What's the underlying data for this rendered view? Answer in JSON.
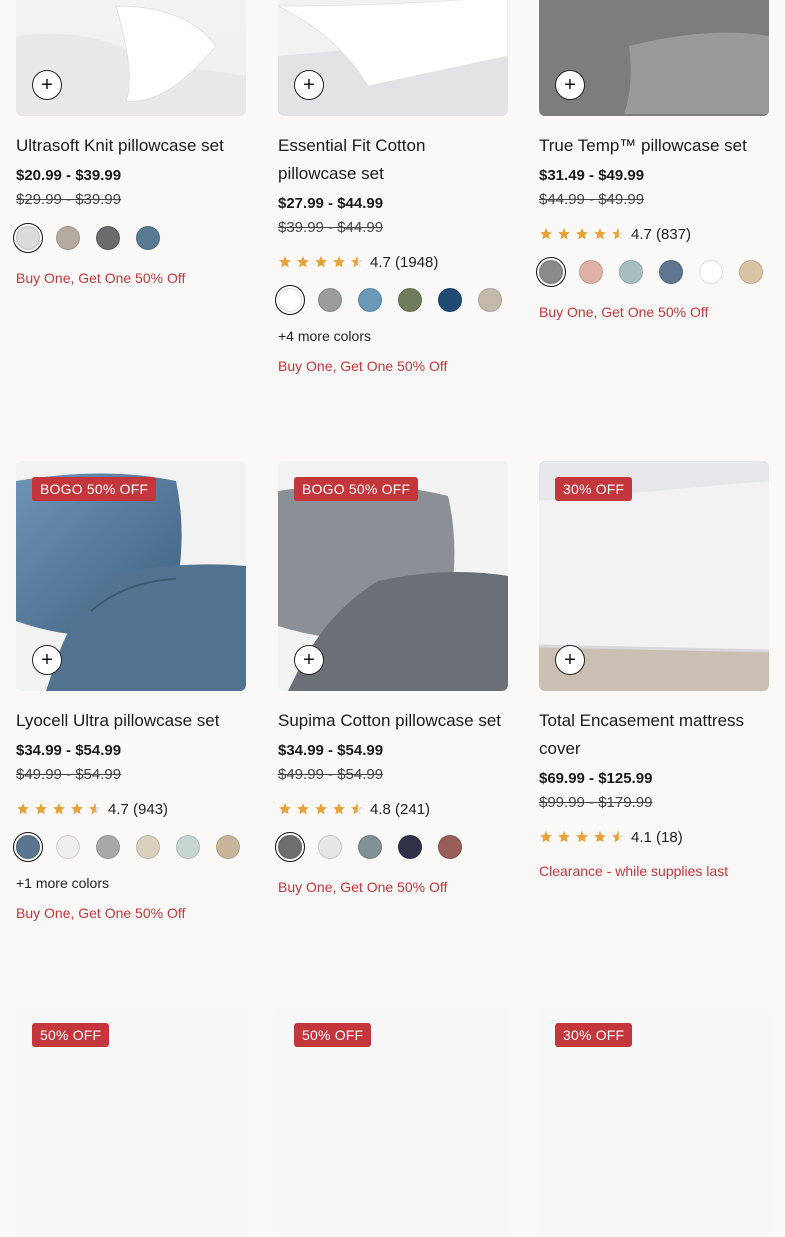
{
  "add_icon": "+",
  "colors": {
    "promo": "#c2363c",
    "star": "#e8a23a",
    "badge_bg": "#c2363c"
  },
  "products": [
    {
      "title": "Ultrasoft Knit pillowcase set",
      "price": "$20.99 - $39.99",
      "original_price": "$29.99 - $39.99",
      "swatches": [
        "#dcdcdc",
        "#b5aaa0",
        "#6a6a6a",
        "#587a92"
      ],
      "promo": "Buy One, Get One 50% Off"
    },
    {
      "title": "Essential Fit Cotton pillowcase set",
      "price": "$27.99 - $44.99",
      "original_price": "$39.99 - $44.99",
      "rating": 4.7,
      "rating_text": "4.7",
      "reviews": "(1948)",
      "swatches": [
        "#ffffff",
        "#9a9d9b",
        "#6a98b6",
        "#6e7e5d",
        "#1f4a72",
        "#c3b8aa"
      ],
      "more_colors": "+4 more colors",
      "promo": "Buy One, Get One 50% Off"
    },
    {
      "title": "True Temp™ pillowcase set",
      "price": "$31.49 - $49.99",
      "original_price": "$44.99 - $49.99",
      "rating": 4.7,
      "rating_text": "4.7",
      "reviews": "(837)",
      "swatches": [
        "#8a8a8a",
        "#ddb0a8",
        "#a8bfc2",
        "#5f7590",
        "#ffffff",
        "#d8c3a5"
      ],
      "promo": "Buy One, Get One 50% Off"
    },
    {
      "badge": "BOGO 50% OFF",
      "title": "Lyocell Ultra pillowcase set",
      "price": "$34.99 - $54.99",
      "original_price": "$49.99 - $54.99",
      "rating": 4.7,
      "rating_text": "4.7",
      "reviews": "(943)",
      "swatches": [
        "#5b7590",
        "#eeeeee",
        "#a8a8a6",
        "#d8d0bd",
        "#c8d6d3",
        "#c8b59a"
      ],
      "more_colors": "+1 more colors",
      "promo": "Buy One, Get One 50% Off"
    },
    {
      "badge": "BOGO 50% OFF",
      "title": "Supima Cotton pillowcase set",
      "price": "$34.99 - $54.99",
      "original_price": "$49.99 - $54.99",
      "rating": 4.8,
      "rating_text": "4.8",
      "reviews": "(241)",
      "swatches": [
        "#6e6e6e",
        "#e6e6e6",
        "#7f9196",
        "#2f3148",
        "#9a5e5a"
      ],
      "promo": "Buy One, Get One 50% Off"
    },
    {
      "badge": "30% OFF",
      "title": "Total Encasement mattress cover",
      "price": "$69.99 - $125.99",
      "original_price": "$99.99 - $179.99",
      "rating": 4.1,
      "rating_text": "4.1",
      "reviews": "(18)",
      "promo": "Clearance - while supplies last"
    }
  ],
  "bottom_badges": [
    "50% OFF",
    "50% OFF",
    "30% OFF"
  ]
}
